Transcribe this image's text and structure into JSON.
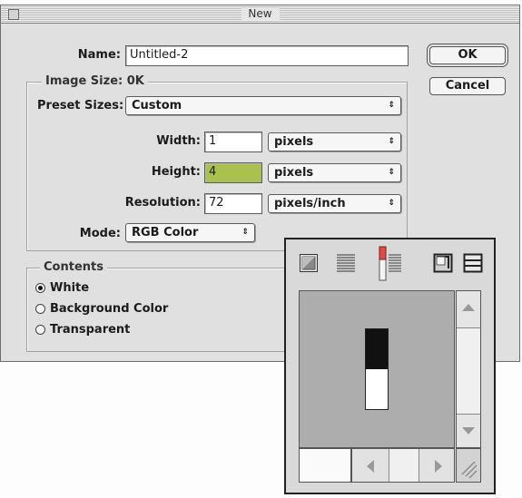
{
  "window": {
    "title": "New"
  },
  "name_field": {
    "label": "Name:",
    "value": "Untitled-2"
  },
  "image_size": {
    "label": "Image Size: 0K"
  },
  "preset": {
    "label": "Preset Sizes:",
    "value": "Custom"
  },
  "width": {
    "label": "Width:",
    "value": "1",
    "unit": "pixels"
  },
  "height": {
    "label": "Height:",
    "value": "4",
    "unit": "pixels"
  },
  "resolution": {
    "label": "Resolution:",
    "value": "72",
    "unit": "pixels/inch"
  },
  "mode": {
    "label": "Mode:",
    "value": "RGB Color"
  },
  "contents": {
    "label": "Contents",
    "options": [
      {
        "label": "White",
        "selected": true
      },
      {
        "label": "Background Color",
        "selected": false
      },
      {
        "label": "Transparent",
        "selected": false
      }
    ]
  },
  "buttons": {
    "ok": "OK",
    "cancel": "Cancel"
  },
  "colors": {
    "dialog_bg": "#e0e0e0",
    "highlight_field": "#a9c24f",
    "palette_canvas": "#adadad"
  },
  "palette": {
    "icons": [
      "fill-square-icon",
      "lines-icon",
      "slider-lines-icon",
      "layout-square-icon",
      "list-box-icon"
    ]
  }
}
